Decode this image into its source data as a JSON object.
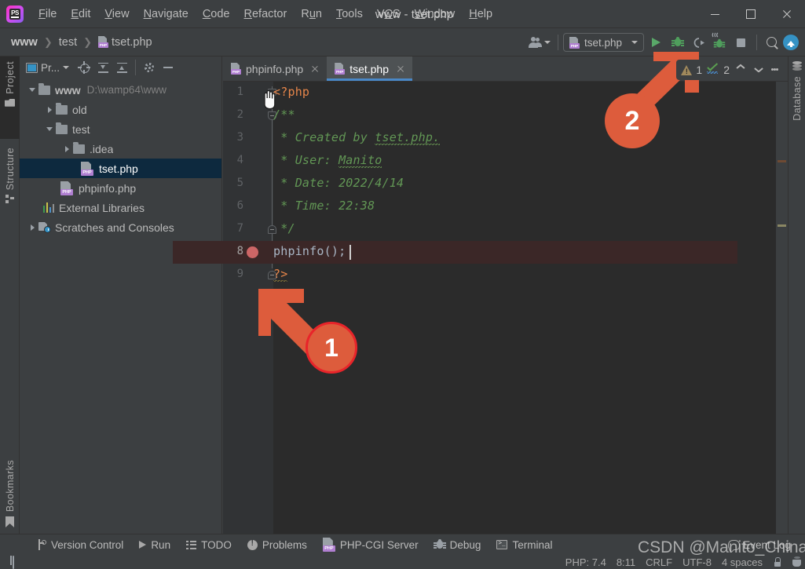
{
  "window": {
    "title": "www - tset.php",
    "app_icon": "phpstorm-logo-icon",
    "minimize_label": "Minimize",
    "maximize_label": "Maximize",
    "close_label": "Close"
  },
  "menubar": {
    "items": [
      {
        "label": "File",
        "mnemonic": "F"
      },
      {
        "label": "Edit",
        "mnemonic": "E"
      },
      {
        "label": "View",
        "mnemonic": "V"
      },
      {
        "label": "Navigate",
        "mnemonic": "N"
      },
      {
        "label": "Code",
        "mnemonic": "C"
      },
      {
        "label": "Refactor",
        "mnemonic": "R"
      },
      {
        "label": "Run",
        "mnemonic": "u"
      },
      {
        "label": "Tools",
        "mnemonic": "T"
      },
      {
        "label": "VCS",
        "mnemonic": "C"
      },
      {
        "label": "Window",
        "mnemonic": "W"
      },
      {
        "label": "Help",
        "mnemonic": "H"
      }
    ]
  },
  "breadcrumb": {
    "items": [
      "www",
      "test",
      "tset.php"
    ],
    "separator": "❯"
  },
  "toolbar": {
    "account_icon": "user-account-icon",
    "run_config": {
      "label": "tset.php",
      "icon": "php-file-icon",
      "dropdown": "▼"
    },
    "run_button": "run-icon",
    "debug_button": "debug-icon",
    "run_with_coverage_button": "run-coverage-icon",
    "attach_debugger_button": "attach-debugger-listen-icon",
    "stop_button": "stop-icon",
    "search_button": "search-icon",
    "update_button": "update-project-icon"
  },
  "left_stripe": {
    "tabs": [
      {
        "label": "Project",
        "icon": "project-folder-icon",
        "active": true
      },
      {
        "label": "Structure",
        "icon": "structure-icon",
        "active": false
      },
      {
        "label": "Bookmarks",
        "icon": "bookmark-icon",
        "active": false
      }
    ]
  },
  "right_stripe": {
    "tabs": [
      {
        "label": "Database",
        "icon": "database-icon",
        "active": false
      }
    ]
  },
  "project_panel": {
    "title": "Pr...",
    "title_dropdown": "▼",
    "actions": [
      {
        "name": "select-opened-file-icon",
        "label": "Select Opened File"
      },
      {
        "name": "expand-all-icon",
        "label": "Expand All"
      },
      {
        "name": "collapse-all-icon",
        "label": "Collapse All"
      },
      {
        "name": "settings-gear-icon",
        "label": "Settings"
      },
      {
        "name": "hide-icon",
        "label": "Hide"
      }
    ],
    "tree": [
      {
        "label": "www",
        "path": "D:\\wamp64\\www",
        "depth": 0,
        "twisty": "down",
        "icon": "folder-icon",
        "bold": true,
        "selected": false
      },
      {
        "label": "old",
        "path": "",
        "depth": 1,
        "twisty": "right",
        "icon": "folder-icon",
        "bold": false,
        "selected": false
      },
      {
        "label": "test",
        "path": "",
        "depth": 1,
        "twisty": "down",
        "icon": "folder-icon",
        "bold": false,
        "selected": false
      },
      {
        "label": ".idea",
        "path": "",
        "depth": 2,
        "twisty": "right",
        "icon": "folder-icon",
        "bold": false,
        "selected": false
      },
      {
        "label": "tset.php",
        "path": "",
        "depth": 3,
        "twisty": "none",
        "icon": "php-file-icon",
        "bold": false,
        "selected": true
      },
      {
        "label": "phpinfo.php",
        "path": "",
        "depth": 2,
        "twisty": "none",
        "icon": "php-file-icon",
        "bold": false,
        "selected": false
      },
      {
        "label": "External Libraries",
        "path": "",
        "depth": 1,
        "twisty": "none",
        "icon": "external-libraries-icon",
        "bold": false,
        "selected": false
      },
      {
        "label": "Scratches and Consoles",
        "path": "",
        "depth": 0,
        "twisty": "right",
        "icon": "scratches-icon",
        "bold": false,
        "selected": false
      }
    ]
  },
  "editor": {
    "tabs": [
      {
        "label": "phpinfo.php",
        "icon": "php-file-icon",
        "active": false,
        "close": "close-icon"
      },
      {
        "label": "tset.php",
        "icon": "php-file-icon",
        "active": true,
        "close": "close-icon"
      }
    ],
    "more_tabs_icon": "more-options-icon",
    "inspection_widget": {
      "warning_icon": "warning-triangle-icon",
      "warning_count": "1",
      "ok_icon": "inspections-ok-icon",
      "ok_count": "2",
      "prev_icon": "chevron-up-icon",
      "next_icon": "chevron-down-icon"
    },
    "lines": [
      {
        "num": "1",
        "fold": "open",
        "segments": [
          {
            "text": "<?php",
            "style": "tag"
          }
        ]
      },
      {
        "num": "2",
        "fold": "open",
        "segments": [
          {
            "text": "/**",
            "style": "doc"
          }
        ]
      },
      {
        "num": "3",
        "fold": "none",
        "segments": [
          {
            "text": " * Created by ",
            "style": "doc"
          },
          {
            "text": "tset.php.",
            "style": "doc-squiggle"
          }
        ]
      },
      {
        "num": "4",
        "fold": "none",
        "segments": [
          {
            "text": " * User: ",
            "style": "doc"
          },
          {
            "text": "Manito",
            "style": "doc-squiggle"
          }
        ]
      },
      {
        "num": "5",
        "fold": "none",
        "segments": [
          {
            "text": " * Date: 2022/4/14",
            "style": "doc"
          }
        ]
      },
      {
        "num": "6",
        "fold": "none",
        "segments": [
          {
            "text": " * Time: 22:38",
            "style": "doc"
          }
        ]
      },
      {
        "num": "7",
        "fold": "close",
        "segments": [
          {
            "text": " */",
            "style": "doc"
          }
        ]
      },
      {
        "num": "8",
        "fold": "none",
        "breakpoint": true,
        "highlight": true,
        "caret_after": true,
        "segments": [
          {
            "text": "phpinfo();",
            "style": "plain"
          }
        ]
      },
      {
        "num": "9",
        "fold": "close",
        "segments": [
          {
            "text": "?>",
            "style": "tag-squiggle"
          }
        ]
      }
    ],
    "stripe_marks": [
      {
        "color": "#6e4a33",
        "top": "100"
      },
      {
        "color": "#8a8763",
        "top": "182"
      }
    ]
  },
  "bottom_bar": {
    "items": [
      {
        "label": "Version Control",
        "icon": "version-control-icon"
      },
      {
        "label": "Run",
        "icon": "run-icon"
      },
      {
        "label": "TODO",
        "icon": "todo-list-icon"
      },
      {
        "label": "Problems",
        "icon": "problems-icon"
      },
      {
        "label": "PHP-CGI Server",
        "icon": "php-file-icon"
      },
      {
        "label": "Debug",
        "icon": "debug-icon"
      },
      {
        "label": "Terminal",
        "icon": "terminal-icon"
      }
    ],
    "event_log": {
      "label": "Event Log",
      "icon": "event-log-icon"
    }
  },
  "status_bar": {
    "left_icon": "toggle-toolbar-icon",
    "items": [
      {
        "label": "PHP: 7.4",
        "name": "php-interpreter-indicator"
      },
      {
        "label": "8:11",
        "name": "caret-position-indicator"
      },
      {
        "label": "CRLF",
        "name": "line-separator-indicator"
      },
      {
        "label": "UTF-8",
        "name": "file-encoding-indicator"
      },
      {
        "label": "4 spaces",
        "name": "indent-indicator"
      }
    ],
    "lock_icon": "read-only-lock-icon",
    "trash_icon": "memory-trash-icon"
  },
  "annotations": [
    {
      "id": "1",
      "label": "1",
      "target": "breakpoint-gutter",
      "style": "ring"
    },
    {
      "id": "2",
      "label": "2",
      "target": "attach-debugger-button",
      "style": "solid"
    }
  ],
  "watermark": {
    "text": "CSDN @Manito_China"
  },
  "colors": {
    "accent": "#3592c4",
    "annotation": "#dd5c3c",
    "annotation_ring": "#e8242a",
    "editor_bg": "#2b2b2b",
    "panel_bg": "#3c3f41",
    "selection": "#0d293e",
    "doc_comment": "#629755",
    "php_tag": "#e8864a",
    "plain_code": "#a9b7c6",
    "breakpoint": "#cc6666",
    "highlight_line": "#3b2727",
    "tab_underline": "#4a88c7"
  }
}
